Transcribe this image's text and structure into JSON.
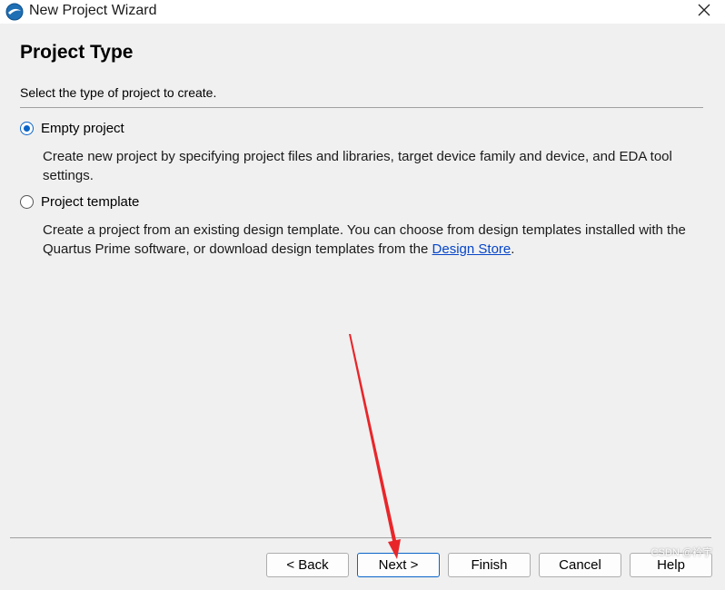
{
  "window": {
    "title": "New Project Wizard",
    "icon": "quartus-app-icon",
    "close_icon": "close-icon"
  },
  "page": {
    "title": "Project Type",
    "subtitle": "Select the type of project to create."
  },
  "options": [
    {
      "label": "Empty project",
      "selected": true,
      "description": "Create new project by specifying project files and libraries, target device family and device, and EDA tool settings."
    },
    {
      "label": "Project template",
      "selected": false,
      "description_prefix": "Create a project from an existing design template. You can choose from design templates installed with the Quartus Prime software, or download design templates from the ",
      "link_text": "Design Store",
      "description_suffix": "."
    }
  ],
  "buttons": {
    "back": "< Back",
    "next": "Next >",
    "finish": "Finish",
    "cancel": "Cancel",
    "help": "Help"
  },
  "annotation": {
    "arrow_color": "#e8262a",
    "points_to": "next-button"
  },
  "watermark": "CSDN @衿宇",
  "colors": {
    "accent": "#0a64c8",
    "link": "#0645c8",
    "background": "#f0f0f0"
  }
}
